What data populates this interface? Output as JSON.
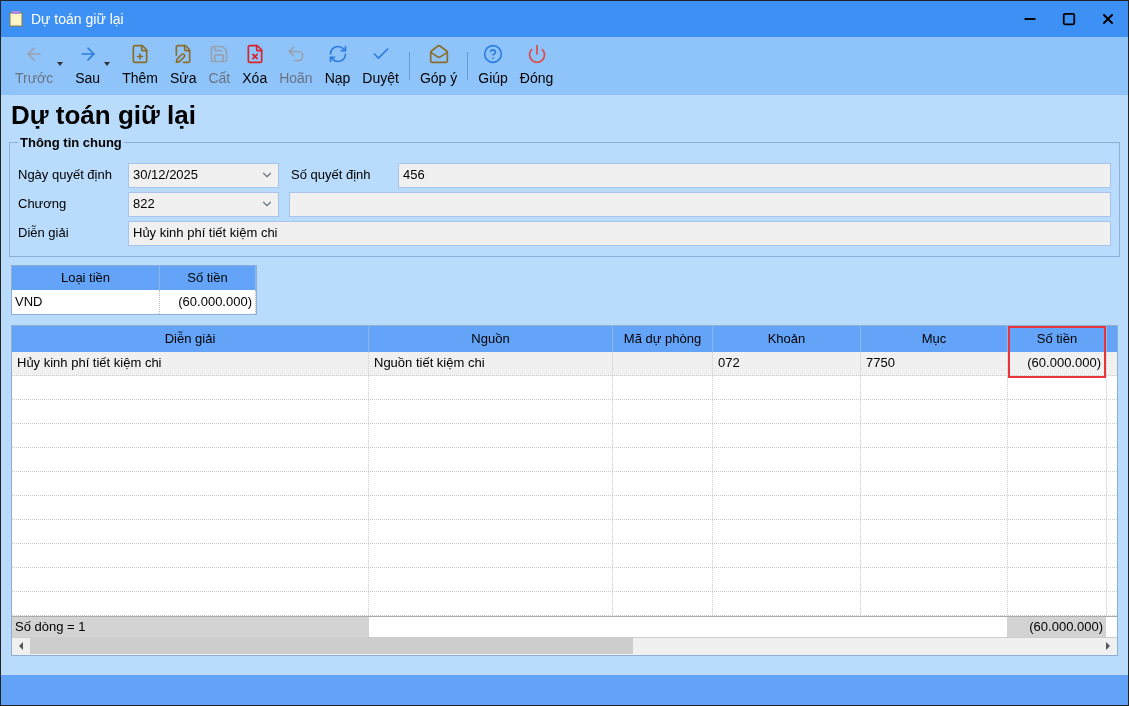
{
  "window": {
    "title": "Dự toán giữ lại"
  },
  "toolbar": [
    {
      "label": "Trước",
      "disabled": true,
      "dropdown": true
    },
    {
      "label": "Sau",
      "disabled": false,
      "dropdown": true
    },
    {
      "label": "Thêm",
      "disabled": false,
      "dropdown": false
    },
    {
      "label": "Sửa",
      "disabled": false,
      "dropdown": false
    },
    {
      "label": "Cất",
      "disabled": true,
      "dropdown": false
    },
    {
      "label": "Xóa",
      "disabled": false,
      "dropdown": false
    },
    {
      "label": "Hoãn",
      "disabled": true,
      "dropdown": false
    },
    {
      "label": "Nạp",
      "disabled": false,
      "dropdown": false
    },
    {
      "label": "Duyệt",
      "disabled": false,
      "dropdown": false
    },
    {
      "label": "Góp ý",
      "disabled": false,
      "dropdown": false
    },
    {
      "label": "Giúp",
      "disabled": false,
      "dropdown": false
    },
    {
      "label": "Đóng",
      "disabled": false,
      "dropdown": false
    }
  ],
  "heading": "Dự toán giữ lại",
  "general_info": {
    "title": "Thông tin chung",
    "decision_date": {
      "label": "Ngày quyết định",
      "value": "30/12/2025"
    },
    "decision_number": {
      "label": "Số quyết định",
      "value": "456"
    },
    "chapter": {
      "label": "Chương",
      "value": "822"
    },
    "description": {
      "label": "Diễn giải",
      "value": "Hủy kinh phí tiết kiệm chi"
    }
  },
  "currency_table": {
    "columns": [
      "Loại tiền",
      "Số tiền"
    ],
    "rows": [
      [
        "VND",
        "(60.000.000)"
      ]
    ]
  },
  "grid": {
    "columns": [
      {
        "label": "Diễn giải",
        "highlighted": false
      },
      {
        "label": "Nguồn",
        "highlighted": false
      },
      {
        "label": "Mã dự phòng",
        "highlighted": false
      },
      {
        "label": "Khoản",
        "highlighted": false
      },
      {
        "label": "Mục",
        "highlighted": false
      },
      {
        "label": "Số tiền",
        "highlighted": true
      }
    ],
    "rows": [
      [
        "Hủy kinh phí tiết kiệm chi",
        "Nguồn tiết kiệm chi",
        "",
        "072",
        "7750",
        "(60.000.000)"
      ]
    ],
    "footer": {
      "row_count": "Số dòng = 1",
      "total": "(60.000.000)"
    }
  }
}
